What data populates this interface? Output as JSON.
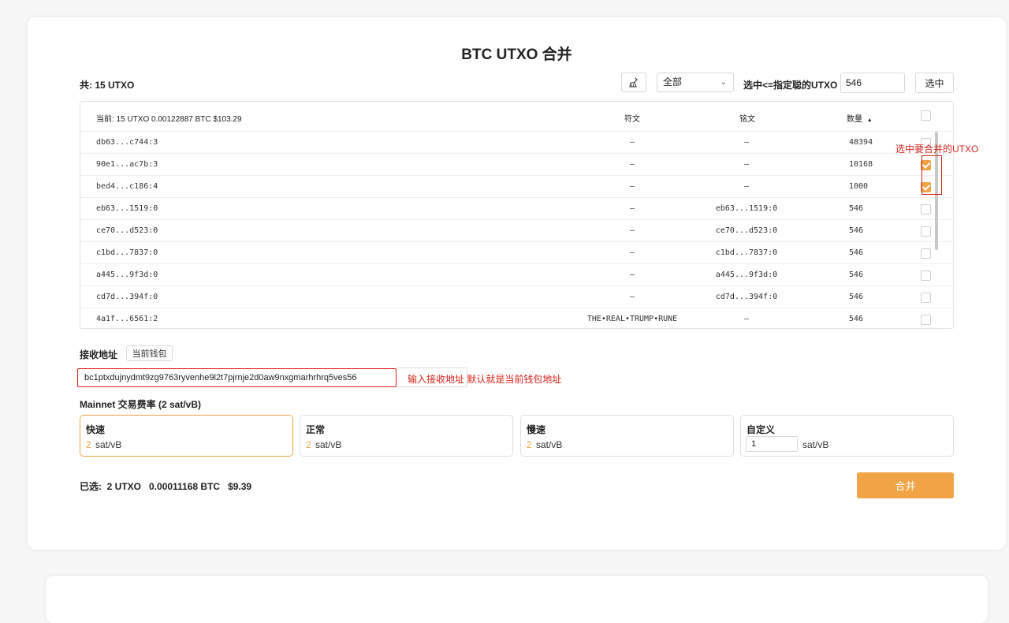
{
  "title": "BTC UTXO 合并",
  "header": {
    "total_label": "共:  15 UTXO",
    "filter_selected": "全部",
    "select_label": "选中<=指定聪的UTXO",
    "select_value": "546",
    "select_button": "选中"
  },
  "table": {
    "summary": "当前: 15 UTXO 0.00122887 BTC $103.29",
    "col_rune": "符文",
    "col_inscription": "铭文",
    "col_amount": "数量",
    "rows": [
      {
        "id": "db63...c744:3",
        "rune": "—",
        "inscription": "—",
        "amount": "48394",
        "checked": false
      },
      {
        "id": "90e1...ac7b:3",
        "rune": "—",
        "inscription": "—",
        "amount": "10168",
        "checked": true
      },
      {
        "id": "bed4...c186:4",
        "rune": "—",
        "inscription": "—",
        "amount": "1000",
        "checked": true
      },
      {
        "id": "eb63...1519:0",
        "rune": "—",
        "inscription": "eb63...1519:0",
        "amount": "546",
        "checked": false
      },
      {
        "id": "ce70...d523:0",
        "rune": "—",
        "inscription": "ce70...d523:0",
        "amount": "546",
        "checked": false
      },
      {
        "id": "c1bd...7837:0",
        "rune": "—",
        "inscription": "c1bd...7837:0",
        "amount": "546",
        "checked": false
      },
      {
        "id": "a445...9f3d:0",
        "rune": "—",
        "inscription": "a445...9f3d:0",
        "amount": "546",
        "checked": false
      },
      {
        "id": "cd7d...394f:0",
        "rune": "—",
        "inscription": "cd7d...394f:0",
        "amount": "546",
        "checked": false
      },
      {
        "id": "4a1f...6561:2",
        "rune": "THE•REAL•TRUMP•RUNE",
        "inscription": "—",
        "amount": "546",
        "checked": false
      }
    ]
  },
  "annotation_select": "选中要合并的UTXO",
  "receive": {
    "label": "接收地址",
    "wallet_button": "当前钱包",
    "address": "bc1ptxdujnydmt9zg9763ryvenhe9l2t7pjrnje2d0aw9nxgmarhrhrq5ves56",
    "hint": "输入接收地址 默认就是当前钱包地址"
  },
  "fee": {
    "title": "Mainnet 交易费率 (2 sat/vB)",
    "options": [
      {
        "name": "快速",
        "value": "2",
        "unit": "sat/vB"
      },
      {
        "name": "正常",
        "value": "2",
        "unit": "sat/vB"
      },
      {
        "name": "慢速",
        "value": "2",
        "unit": "sat/vB"
      }
    ],
    "custom": {
      "name": "自定义",
      "value": "1",
      "unit": "sat/vB"
    }
  },
  "footer": {
    "selected": "已选:  2 UTXO   0.00011168 BTC   $9.39",
    "merge_button": "合并"
  },
  "colors": {
    "accent": "#f0a446",
    "annotation": "#d9251c"
  },
  "icons": {
    "clear": "broom-icon",
    "dropdown": "chevron-down-icon",
    "sort": "sort-up-icon"
  }
}
